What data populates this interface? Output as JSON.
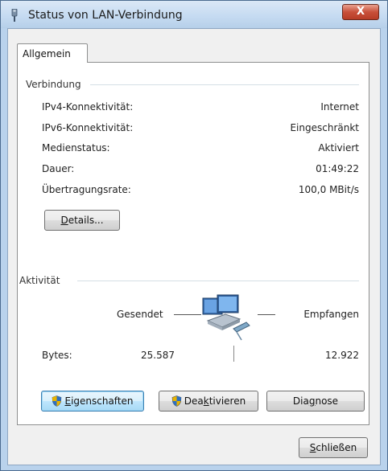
{
  "window": {
    "title": "Status von LAN-Verbindung",
    "close_label": "X"
  },
  "tabs": [
    {
      "label": "Allgemein"
    }
  ],
  "connection": {
    "group_label": "Verbindung",
    "rows": [
      {
        "label": "IPv4-Konnektivität:",
        "value": "Internet"
      },
      {
        "label": "IPv6-Konnektivität:",
        "value": "Eingeschränkt"
      },
      {
        "label": "Medienstatus:",
        "value": "Aktiviert"
      },
      {
        "label": "Dauer:",
        "value": "01:49:22"
      },
      {
        "label": "Übertragungsrate:",
        "value": "100,0 MBit/s"
      }
    ],
    "details_button": {
      "pre": "",
      "mnemonic": "D",
      "post": "etails..."
    }
  },
  "activity": {
    "group_label": "Aktivität",
    "sent_label": "Gesendet",
    "received_label": "Empfangen",
    "bytes_label": "Bytes:",
    "bytes_sent": "25.587",
    "bytes_received": "12.922"
  },
  "buttons": {
    "properties": {
      "pre": "",
      "mnemonic": "E",
      "post": "igenschaften"
    },
    "deactivate": {
      "pre": "Dea",
      "mnemonic": "k",
      "post": "tivieren"
    },
    "diagnose": {
      "pre": "Dia",
      "mnemonic": "g",
      "post": "nose"
    },
    "close": {
      "pre": "",
      "mnemonic": "S",
      "post": "chließen"
    }
  },
  "colors": {
    "title_bar": "#c4daf1",
    "close_button": "#c8503a",
    "focus_border": "#3c7fb1"
  },
  "icons": {
    "title": "network-plug-icon",
    "activity": "network-computers-icon",
    "uac": "uac-shield-icon"
  }
}
